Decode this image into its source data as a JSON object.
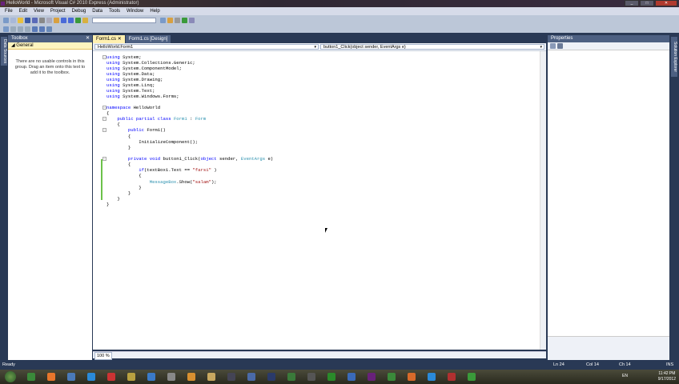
{
  "window": {
    "title": "HelloWorld - Microsoft Visual C# 2010 Express (Administrator)"
  },
  "menu": [
    "File",
    "Edit",
    "View",
    "Project",
    "Debug",
    "Data",
    "Tools",
    "Window",
    "Help"
  ],
  "sidebars": {
    "left_tab": "Data Sources",
    "right_tab": "Solution Explorer"
  },
  "toolbox": {
    "title": "Toolbox",
    "group": "General",
    "message": "There are no usable controls in this group. Drag an item onto this text to add it to the toolbox."
  },
  "editor": {
    "tabs": [
      "Form1.cs",
      "Form1.cs [Design]"
    ],
    "type_selector": "HelloWorld.Form1",
    "member_selector": "button1_Click(object sender, EventArgs e)",
    "zoom": "100 %",
    "code": [
      [
        [
          "using",
          "kw"
        ],
        [
          " System;",
          ""
        ]
      ],
      [
        [
          "using",
          "kw"
        ],
        [
          " System.Collections.Generic;",
          ""
        ]
      ],
      [
        [
          "using",
          "kw"
        ],
        [
          " System.ComponentModel;",
          ""
        ]
      ],
      [
        [
          "using",
          "kw"
        ],
        [
          " System.Data;",
          ""
        ]
      ],
      [
        [
          "using",
          "kw"
        ],
        [
          " System.Drawing;",
          ""
        ]
      ],
      [
        [
          "using",
          "kw"
        ],
        [
          " System.Linq;",
          ""
        ]
      ],
      [
        [
          "using",
          "kw"
        ],
        [
          " System.Text;",
          ""
        ]
      ],
      [
        [
          "using",
          "kw"
        ],
        [
          " System.Windows.Forms;",
          ""
        ]
      ],
      [],
      [
        [
          "namespace",
          "kw"
        ],
        [
          " HelloWorld",
          ""
        ]
      ],
      [
        [
          "{",
          ""
        ]
      ],
      [
        [
          "    public partial class",
          "kw"
        ],
        [
          " ",
          ""
        ],
        [
          "Form1",
          "ty"
        ],
        [
          " : ",
          ""
        ],
        [
          "Form",
          "ty"
        ]
      ],
      [
        [
          "    {",
          ""
        ]
      ],
      [
        [
          "        public",
          "kw"
        ],
        [
          " Form1()",
          ""
        ]
      ],
      [
        [
          "        {",
          ""
        ]
      ],
      [
        [
          "            InitializeComponent();",
          ""
        ]
      ],
      [
        [
          "        }",
          ""
        ]
      ],
      [],
      [
        [
          "        private void",
          "kw"
        ],
        [
          " button1_Click(",
          ""
        ],
        [
          "object",
          "kw"
        ],
        [
          " sender, ",
          ""
        ],
        [
          "EventArgs",
          "ty"
        ],
        [
          " e)",
          ""
        ]
      ],
      [
        [
          "        {",
          ""
        ]
      ],
      [
        [
          "            if",
          "kw"
        ],
        [
          "(textBox1.Text == ",
          ""
        ],
        [
          "\"farsi\"",
          "str"
        ],
        [
          " )",
          ""
        ]
      ],
      [
        [
          "            {",
          ""
        ]
      ],
      [
        [
          "                ",
          ""
        ],
        [
          "MessageBox",
          "ty"
        ],
        [
          ".Show(",
          ""
        ],
        [
          "\"salam\"",
          "str"
        ],
        [
          ");",
          ""
        ]
      ],
      [
        [
          "            }",
          ""
        ]
      ],
      [
        [
          "        }",
          ""
        ]
      ],
      [
        [
          "    }",
          ""
        ]
      ],
      [
        [
          "}",
          ""
        ]
      ]
    ]
  },
  "properties": {
    "title": "Properties"
  },
  "status": {
    "left": "Ready",
    "ln": "Ln 24",
    "col": "Col 14",
    "ch": "Ch 14",
    "mode": "INS"
  },
  "tray": {
    "lang": "EN",
    "time": "11:42 PM",
    "date": "9/17/2012"
  },
  "taskbar_colors": [
    "#3a8a3a",
    "#e8762b",
    "#4a7ab8",
    "#2a8ad8",
    "#c33",
    "#b8a040",
    "#3a7ac8",
    "#888",
    "#d89030",
    "#c8a860",
    "#445",
    "#4a6aa8",
    "#2a3a6a",
    "#3a7a3a",
    "#555",
    "#2a8a2a",
    "#3a6ab8",
    "#68217a",
    "#3a8a3a",
    "#d86a2a",
    "#2a8ad8",
    "#b03030",
    "#3a9a3a"
  ]
}
